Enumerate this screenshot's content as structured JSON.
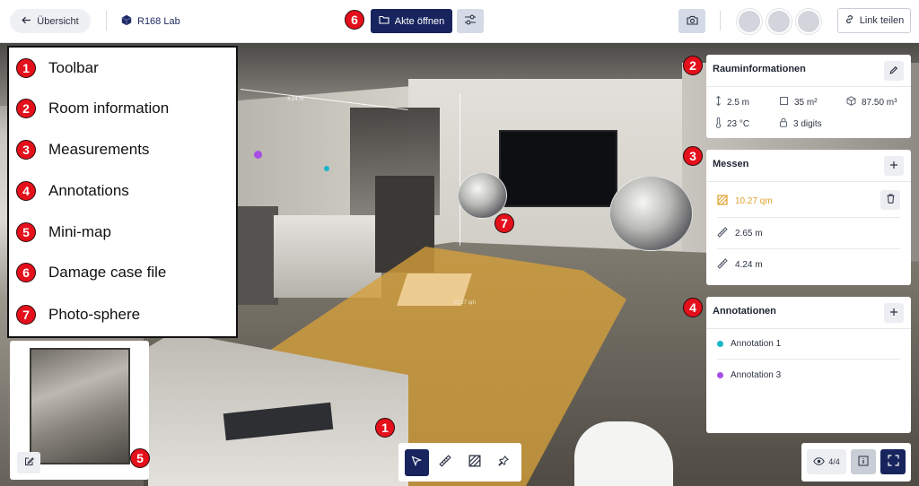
{
  "topbar": {
    "back_label": "Übersicht",
    "project_name": "R168 Lab",
    "open_file_label": "Akte öffnen",
    "share_label": "Link teilen"
  },
  "legend": [
    {
      "num": "1",
      "label": "Toolbar"
    },
    {
      "num": "2",
      "label": "Room information"
    },
    {
      "num": "3",
      "label": "Measurements"
    },
    {
      "num": "4",
      "label": "Annotations"
    },
    {
      "num": "5",
      "label": "Mini-map"
    },
    {
      "num": "6",
      "label": "Damage case file"
    },
    {
      "num": "7",
      "label": "Photo-sphere"
    }
  ],
  "room_info": {
    "title": "Rauminformationen",
    "height": "2.5 m",
    "area": "35 m²",
    "volume": "87.50 m³",
    "temperature": "23 °C",
    "lock_code": "3 digits"
  },
  "measurements": {
    "title": "Messen",
    "items": [
      {
        "type": "area",
        "value": "10.27 qm"
      },
      {
        "type": "length",
        "value": "2.65 m"
      },
      {
        "type": "length",
        "value": "4.24 m"
      }
    ]
  },
  "annotations": {
    "title": "Annotationen",
    "items": [
      {
        "label": "Annotation 1",
        "color": "#19b6c8"
      },
      {
        "label": "Annotation 3",
        "color": "#a84ee6"
      }
    ]
  },
  "scene": {
    "area_label": "10.27 qm",
    "line_label": "4.24 m"
  },
  "view": {
    "count": "4/4"
  },
  "colors": {
    "navy": "#17245e",
    "measure": "#e0a12d",
    "callout": "#e4101b"
  },
  "icons": {
    "toolbar": [
      "cursor-icon",
      "ruler-icon",
      "area-icon",
      "pin-icon"
    ]
  }
}
